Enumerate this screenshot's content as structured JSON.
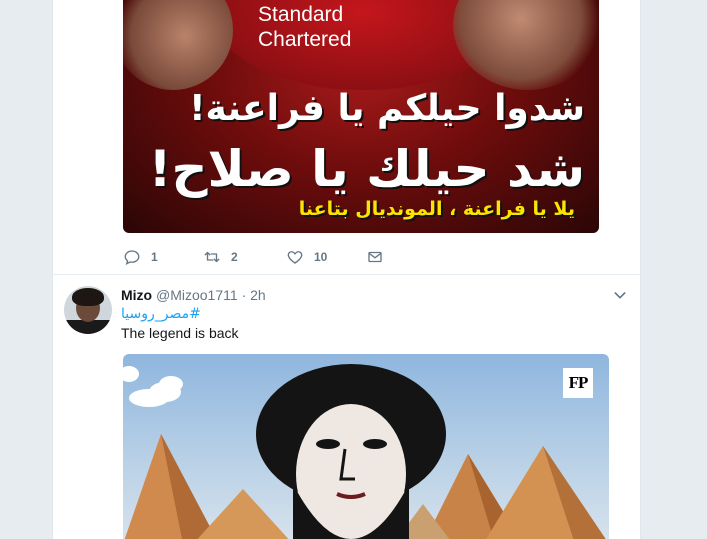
{
  "tweet1": {
    "image": {
      "sponsor": "Standard\nChartered",
      "arabic_line1": "شدوا حيلكم يا فراعنة!",
      "arabic_line2": "شد حيلك يا صلاح!",
      "arabic_line3": "يلا يا فراعنة ، المونديال بتاعنا"
    },
    "actions": {
      "reply_count": "1",
      "retweet_count": "2",
      "like_count": "10",
      "reply_icon": "reply-icon",
      "retweet_icon": "retweet-icon",
      "like_icon": "heart-icon",
      "dm_icon": "envelope-icon"
    }
  },
  "tweet2": {
    "name": "Mizo",
    "handle": "@Mizoo1711",
    "separator": "·",
    "time": "2h",
    "hashtag": "#مصر_روسيا",
    "text": "The legend is back",
    "image_logo": "FP"
  },
  "colors": {
    "link": "#1da1f2",
    "muted": "#657786",
    "background": "#e6ecf0"
  }
}
